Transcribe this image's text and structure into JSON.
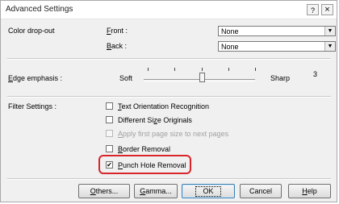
{
  "window": {
    "title": "Advanced Settings",
    "help_glyph": "?",
    "close_glyph": "×"
  },
  "color_dropout": {
    "label": "Color drop-out",
    "front_label_u": "F",
    "front_label_rest": "ront :",
    "front_value": "None",
    "back_label_u": "B",
    "back_label_rest": "ack :",
    "back_value": "None"
  },
  "edge_emphasis": {
    "label_u": "E",
    "label_rest": "dge emphasis :",
    "soft": "Soft",
    "sharp": "Sharp",
    "value": "3",
    "level_fraction": 0.5
  },
  "filter_settings": {
    "label": "Filter Settings :",
    "options": [
      {
        "label_u": "T",
        "label_rest": "ext Orientation Recognition",
        "checked": false,
        "enabled": true
      },
      {
        "label_pre": "Different Si",
        "label_u": "z",
        "label_rest": "e Originals",
        "checked": false,
        "enabled": true
      },
      {
        "label_u": "A",
        "label_rest": "pply first page size to next pages",
        "checked": false,
        "enabled": false
      },
      {
        "label_u": "B",
        "label_rest": "order Removal",
        "checked": false,
        "enabled": true
      },
      {
        "label_u": "P",
        "label_rest": "unch Hole Removal",
        "checked": true,
        "enabled": true
      }
    ]
  },
  "buttons": {
    "others_u": "O",
    "others_rest": "thers...",
    "gamma_u": "G",
    "gamma_rest": "amma...",
    "ok": "OK",
    "cancel": "Cancel",
    "help_u": "H",
    "help_rest": "elp"
  },
  "colors": {
    "highlight": "#d9252a",
    "window_bg": "#f0f0f0"
  }
}
